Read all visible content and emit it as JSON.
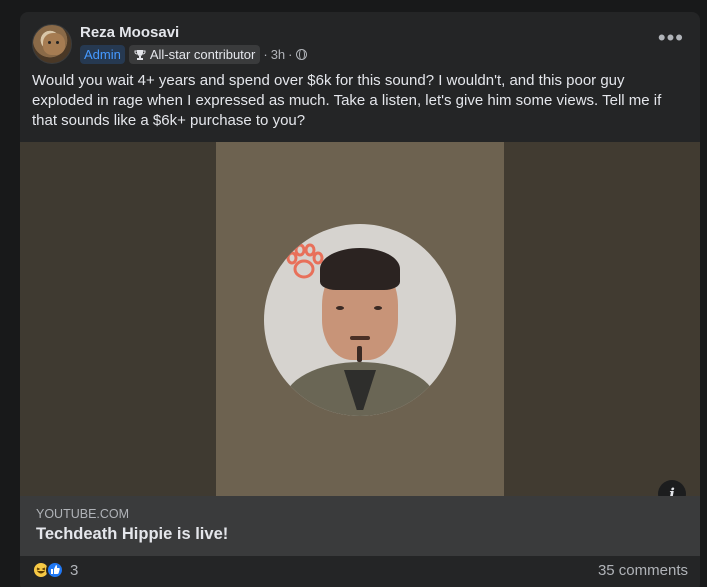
{
  "post": {
    "author": "Reza Moosavi",
    "badges": {
      "admin": "Admin",
      "allstar": "All-star contributor"
    },
    "time": "3h",
    "separator": "·",
    "text": "Would you wait 4+ years and spend over $6k for this sound? I wouldn't, and this poor guy exploded in rage when I expressed as much. Take a listen, let's give him some views. Tell me if that sounds like a $6k+ purchase to you?"
  },
  "link": {
    "domain": "YOUTUBE.COM",
    "title": "Techdeath Hippie is live!"
  },
  "icons": {
    "more": "more-options-icon",
    "trophy": "trophy-icon",
    "audience": "globe-icon",
    "info": "info-icon",
    "haha": "haha-reaction-icon",
    "like": "like-reaction-icon"
  },
  "footer": {
    "reaction_count": "3",
    "comments": "35 comments"
  },
  "colors": {
    "background": "#18191a",
    "card": "#242526",
    "link_box": "#3a3b3c",
    "admin_badge_text": "#4599ff",
    "like_blue": "#2078f4",
    "haha_yellow": "#f7c945"
  }
}
